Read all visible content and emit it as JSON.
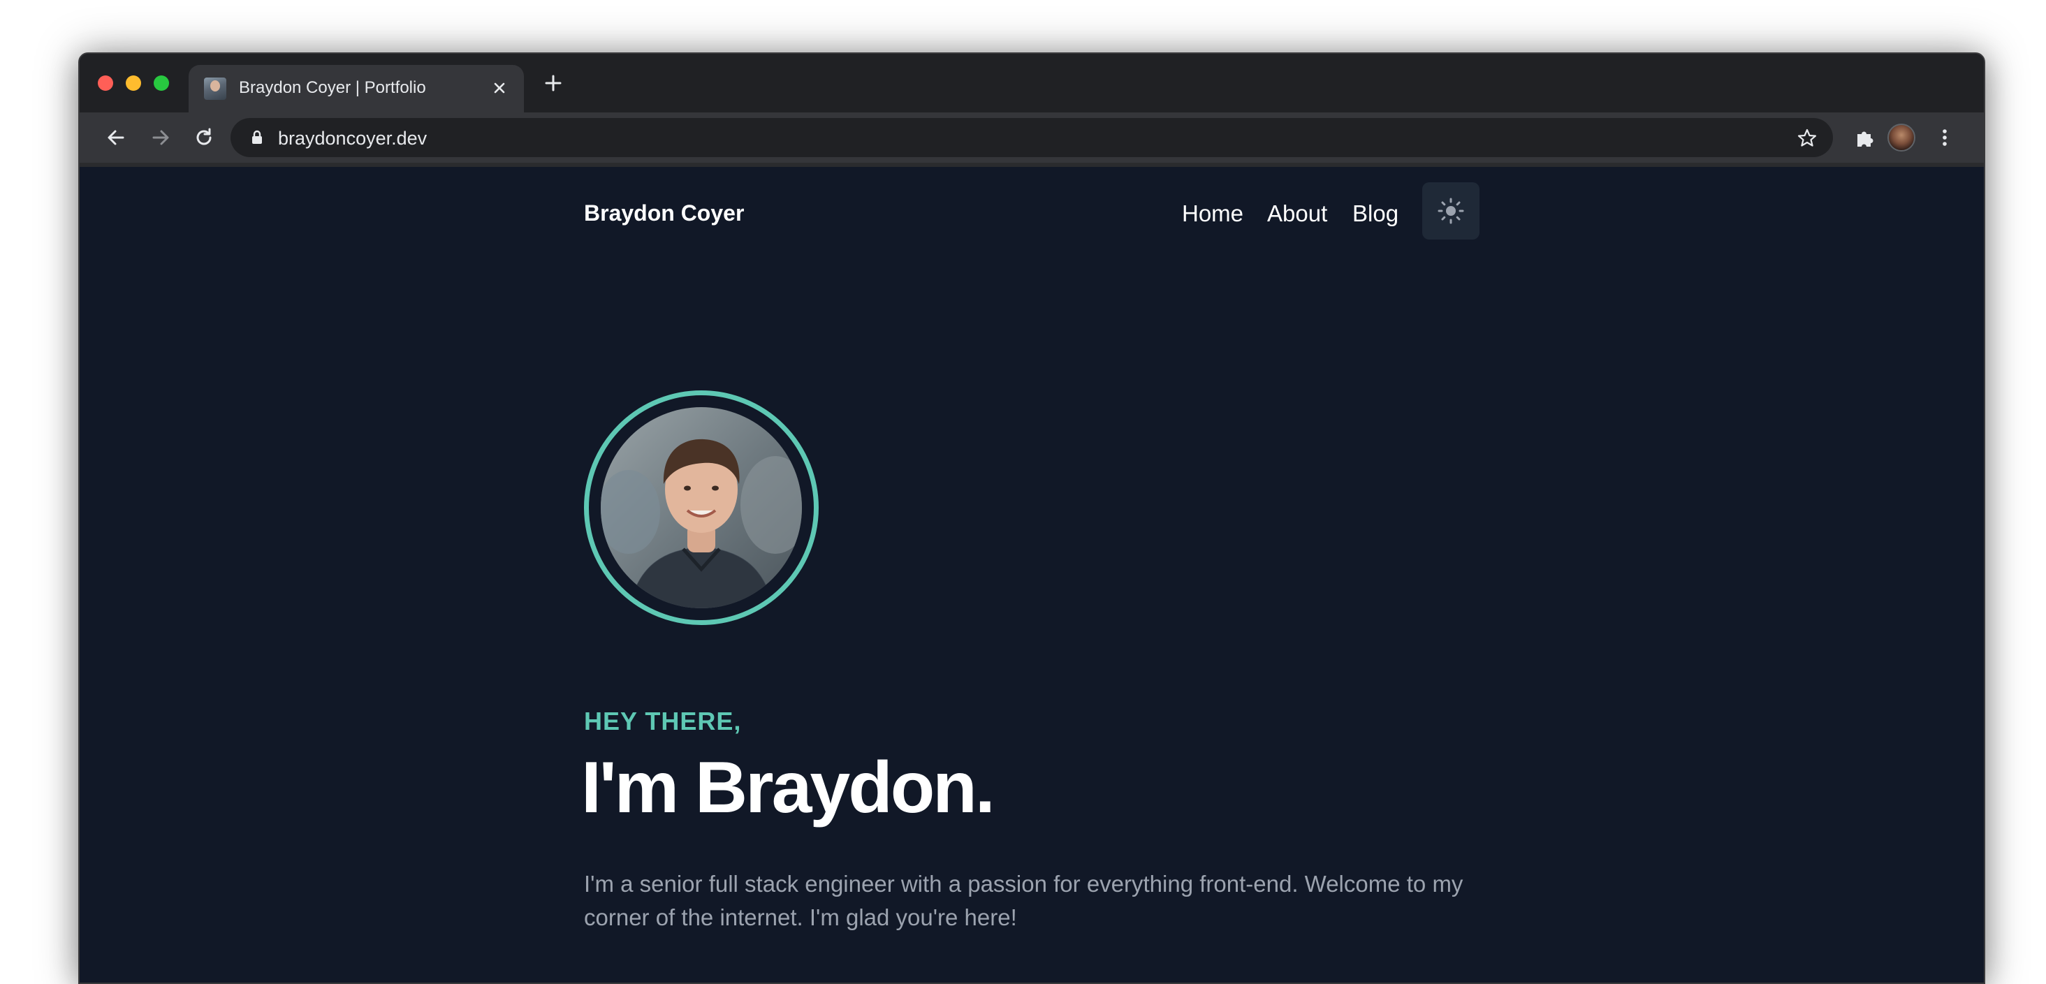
{
  "browser": {
    "tab_title": "Braydon Coyer | Portfolio",
    "tab_close_icon": "close-icon",
    "new_tab_icon": "plus-icon",
    "url": "braydoncoyer.dev",
    "back_icon": "arrow-left-icon",
    "forward_icon": "arrow-right-icon",
    "reload_icon": "reload-icon",
    "lock_icon": "lock-icon",
    "bookmark_icon": "star-icon",
    "extensions_icon": "puzzle-icon",
    "menu_icon": "kebab-menu-icon"
  },
  "site": {
    "name": "Braydon Coyer",
    "nav": {
      "home": "Home",
      "about": "About",
      "blog": "Blog"
    },
    "theme_toggle_icon": "sun-icon"
  },
  "hero": {
    "greeting": "HEY THERE,",
    "headline": "I'm Braydon.",
    "intro": "I'm a senior full stack engineer with a passion for everything front-end. Welcome to my corner of the internet. I'm glad you're here!"
  },
  "colors": {
    "page_bg": "#111827",
    "accent": "#5ec8b4",
    "body_text": "#9ca3af",
    "toggle_bg": "#1f2937"
  }
}
